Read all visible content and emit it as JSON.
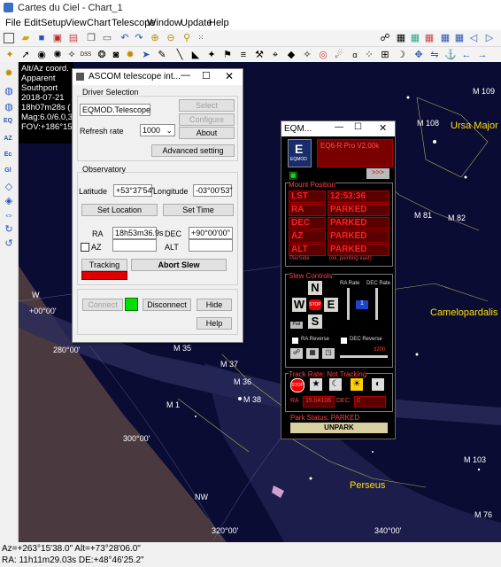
{
  "window": {
    "title": "Cartes du Ciel - Chart_1"
  },
  "menu": [
    "File",
    "Edit",
    "Setup",
    "View",
    "Chart",
    "Telescope",
    "Window",
    "Update",
    "Help"
  ],
  "overlay": {
    "line1": "Alt/Az coord.",
    "line2": "Apparent",
    "line3": "Southport",
    "line4": "2018-07-21",
    "line5": "18h07m28s (",
    "line6": "Mag:6.0/6.0,3",
    "line7": "FOV:+186°15"
  },
  "ascom": {
    "title": "ASCOM telescope int...",
    "driver_selection": "Driver Selection",
    "driver_value": "EQMOD.Telescope",
    "select_label": "Select",
    "configure_label": "Configure",
    "refresh_rate_label": "Refresh rate",
    "refresh_rate_value": "1000",
    "about_label": "About",
    "advanced_label": "Advanced setting",
    "observatory": "Observatory",
    "latitude_label": "Latitude",
    "latitude_value": "+53°37'54\"",
    "longitude_label": "Longitude",
    "longitude_value": "-03°00'53\"",
    "set_location_label": "Set Location",
    "set_time_label": "Set Time",
    "ra_label": "RA",
    "ra_value": "18h53m36.9s",
    "dec_label": "DEC",
    "dec_value": "+90°00'00\"",
    "az_label": "AZ",
    "alt_label": "ALT",
    "tracking_label": "Tracking",
    "abort_label": "Abort Slew",
    "connect_label": "Connect",
    "disconnect_label": "Disconnect",
    "hide_label": "Hide",
    "help_label": "Help"
  },
  "eqmod": {
    "title": "EQM...",
    "logo": "EQMOD",
    "model": "EQ6-R Pro V2.00k",
    "mount_position": "Mount Position",
    "lst_label": "LST",
    "lst_value": "12:53:36",
    "ra_label": "RA",
    "ra_value": "PARKED",
    "dec_label": "DEC",
    "dec_value": "PARKED",
    "az_label": "AZ",
    "az_value": "PARKED",
    "alt_label": "ALT",
    "alt_value": "PARKED",
    "pier_label": "PierSide",
    "pier_value": "(ok, pointing east)",
    "slew_controls": "Slew Controls",
    "ra_rate": "RA Rate",
    "dec_rate": "DEC Rate",
    "rate_value": "1",
    "n": "N",
    "s": "S",
    "e": "E",
    "w": "W",
    "stop": "STOP",
    "ra_reverse": "RA Reverse",
    "dec_reverse": "DEC Reverse",
    "slider_value": "3200",
    "track_rate": "Track Rate: Not Tracking",
    "track_ra_label": "RA",
    "track_ra_value": "15.04106",
    "track_dec_label": "DEC",
    "track_dec_value": "0",
    "park_status": "Park Status: PARKED",
    "unpark_label": "UNPARK"
  },
  "sky": {
    "labels": {
      "m109": "M 109",
      "m108": "M 108",
      "ursa": "Ursa Major",
      "m81": "M 81",
      "m82": "M 82",
      "camel": "Camelopardalis",
      "m35": "M 35",
      "m37": "M 37",
      "m36": "M 36",
      "m38": "M 38",
      "m1": "M 1",
      "m103": "M 103",
      "perseus": "Perseus",
      "m76": "M 76",
      "nw": "NW",
      "w": "W",
      "alt0": "+00°00'",
      "deg280": "280°00'",
      "deg300": "300°00'",
      "deg320": "320°00'",
      "deg340": "340°00'"
    }
  },
  "status": {
    "line1": "Az=+263°15'38.0\" Alt=+73°28'06.0\"",
    "line2": "RA: 11h11m29.03s DE:+48°46'25.2\""
  }
}
